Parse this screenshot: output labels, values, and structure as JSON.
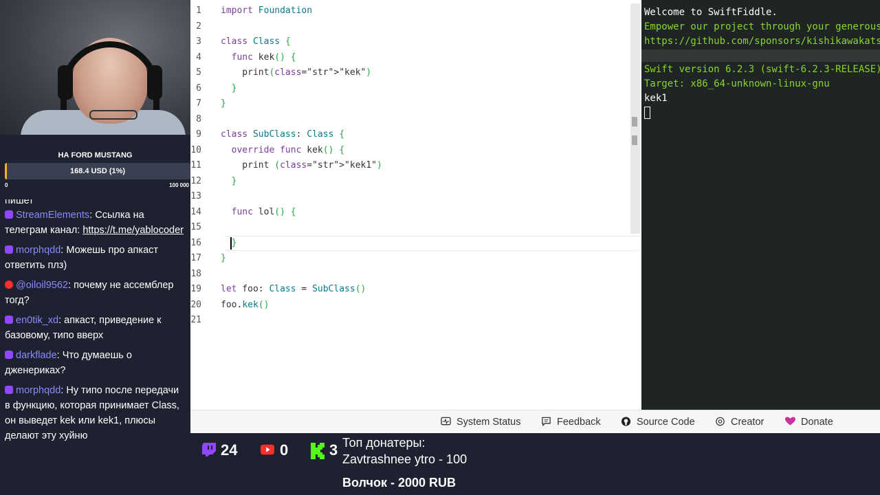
{
  "goal": {
    "title": "НА FORD MUSTANG",
    "progress_text": "168.4 USD (1%)",
    "progress_fraction": 0.01,
    "min_label": "0",
    "max_label": "100 000"
  },
  "chat": {
    "cut_text": "пишет",
    "messages": [
      {
        "platform": "twitch",
        "user": "StreamElements",
        "text": "Ссылка на телеграм канал: ",
        "link": "https://t.me/yablocoder"
      },
      {
        "platform": "twitch",
        "user": "morphqdd",
        "text": "Можешь про апкаст ответить плз)"
      },
      {
        "platform": "youtube",
        "user": "@oiloil9562",
        "text": "почему не ассемблер тогд?"
      },
      {
        "platform": "twitch",
        "user": "en0tik_xd",
        "text": "апкаст, приведение к базовому, типо вверх"
      },
      {
        "platform": "twitch",
        "user": "darkflade",
        "text": "Что думаешь о дженериках?"
      },
      {
        "platform": "twitch",
        "user": "morphqdd",
        "text": "Ну типо после передачи в функцию, которая принимает Class, он выведет kek или kek1, плюсы делают эту хуйню"
      }
    ]
  },
  "editor": {
    "lines": [
      {
        "n": "1",
        "code": "import Foundation"
      },
      {
        "n": "2",
        "code": ""
      },
      {
        "n": "3",
        "code": "class Class {"
      },
      {
        "n": "4",
        "code": "  func kek() {"
      },
      {
        "n": "5",
        "code": "    print(\"kek\")"
      },
      {
        "n": "6",
        "code": "  }"
      },
      {
        "n": "7",
        "code": "}"
      },
      {
        "n": "8",
        "code": ""
      },
      {
        "n": "9",
        "code": "class SubClass: Class {"
      },
      {
        "n": "10",
        "code": "  override func kek() {"
      },
      {
        "n": "11",
        "code": "    print (\"kek1\")"
      },
      {
        "n": "12",
        "code": "  }"
      },
      {
        "n": "13",
        "code": ""
      },
      {
        "n": "14",
        "code": "  func lol() {"
      },
      {
        "n": "15",
        "code": ""
      },
      {
        "n": "16",
        "code": "  }"
      },
      {
        "n": "17",
        "code": "}"
      },
      {
        "n": "18",
        "code": ""
      },
      {
        "n": "19",
        "code": "let foo: Class = SubClass()"
      },
      {
        "n": "20",
        "code": "foo.kek()"
      },
      {
        "n": "21",
        "code": ""
      }
    ]
  },
  "terminal": {
    "welcome": "Welcome to SwiftFiddle.",
    "sponsor_line1": "Empower our project through your generous support on GitHub Sponsors!",
    "sponsor_line2": "https://github.com/sponsors/kishikawakatsumi/",
    "version": "Swift version 6.2.3 (swift-6.2.3-RELEASE)",
    "target": "Target: x86_64-unknown-linux-gnu",
    "output": "kek1"
  },
  "footer": {
    "system_status": "System Status",
    "feedback": "Feedback",
    "source_code": "Source Code",
    "creator": "Creator",
    "donate": "Donate"
  },
  "streambar": {
    "twitch_count": "24",
    "youtube_count": "0",
    "kick_count": "3",
    "donors_title": "Топ донатеры:",
    "donors_top": "Zavtrashnee ytro - 100",
    "donors_recent": "Волчок - 2000 RUB"
  },
  "colors": {
    "twitch": "#9147ff",
    "youtube": "#ff2d2d",
    "kick": "#53fc18",
    "goal_fill": "#ffb020",
    "donate_heart": "#c7359c"
  }
}
